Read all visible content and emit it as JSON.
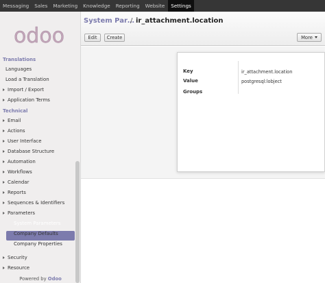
{
  "topbar": {
    "items": [
      "Messaging",
      "Sales",
      "Marketing",
      "Knowledge",
      "Reporting",
      "Website"
    ],
    "active": "Settings"
  },
  "logo": {
    "text": "odoo"
  },
  "sidebar": {
    "sections": [
      {
        "header": "Translations",
        "items": [
          "Languages",
          "Load a Translation",
          "Import / Export",
          "Application Terms"
        ]
      },
      {
        "header": "Technical",
        "items": [
          "Email",
          "Actions",
          "User Interface",
          "Database Structure",
          "Automation",
          "Workflows",
          "Calendar",
          "Reports",
          "Sequences & Identifiers",
          "Parameters"
        ]
      }
    ],
    "parameters_children": [
      "System Parameters",
      "Company Defaults",
      "Company Properties"
    ],
    "bottom_items": [
      "Security",
      "Resource"
    ],
    "powered_by": "Powered by",
    "powered_brand": "Odoo"
  },
  "breadcrumb": {
    "root": "System Par…",
    "separator": "/",
    "current": "ir_attachment.location"
  },
  "buttons": {
    "edit": "Edit",
    "create": "Create",
    "more": "More"
  },
  "form": {
    "fields": [
      {
        "label": "Key",
        "value": "ir_attachment.location"
      },
      {
        "label": "Value",
        "value": "postgresql:lobject"
      },
      {
        "label": "Groups",
        "value": ""
      }
    ]
  },
  "colors": {
    "accent": "#7c7bad",
    "topbar": "#363636",
    "active_menu": "#0f0f0f"
  }
}
